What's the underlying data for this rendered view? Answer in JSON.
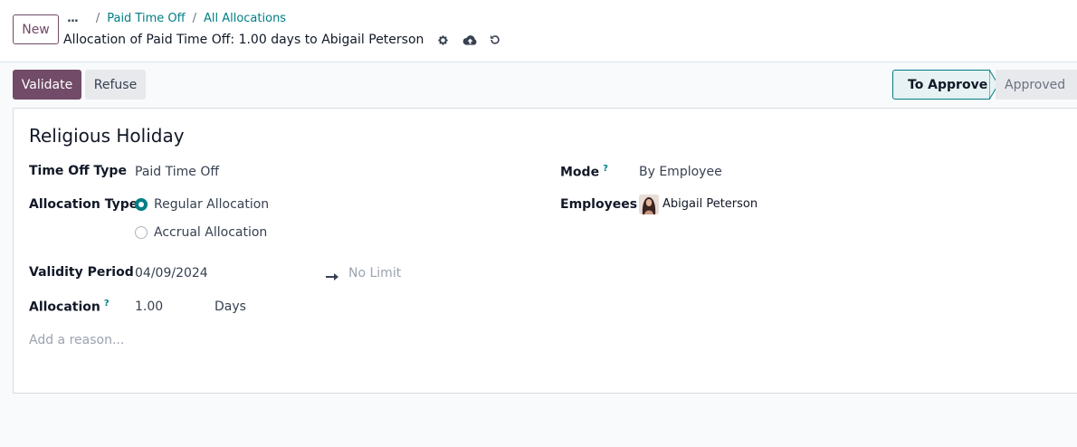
{
  "control_panel": {
    "new_label": "New",
    "breadcrumb": {
      "ellipsis": "...",
      "items": [
        "Paid Time Off",
        "All Allocations"
      ]
    },
    "record_title": "Allocation of Paid Time Off: 1.00 days to Abigail Peterson"
  },
  "status_bar": {
    "validate_label": "Validate",
    "refuse_label": "Refuse",
    "stages": [
      "To Approve",
      "Approved"
    ],
    "current_stage": "To Approve"
  },
  "form": {
    "name": "Religious Holiday",
    "time_off_type": {
      "label": "Time Off Type",
      "value": "Paid Time Off"
    },
    "allocation_type": {
      "label": "Allocation Type",
      "options": [
        "Regular Allocation",
        "Accrual Allocation"
      ],
      "selected": "Regular Allocation"
    },
    "validity_period": {
      "label": "Validity Period",
      "start": "04/09/2024",
      "end_placeholder": "No Limit"
    },
    "allocation": {
      "label": "Allocation",
      "help": "?",
      "value": "1.00",
      "unit": "Days"
    },
    "reason_placeholder": "Add a reason...",
    "mode": {
      "label": "Mode",
      "help": "?",
      "value": "By Employee"
    },
    "employees": {
      "label": "Employees",
      "values": [
        "Abigail Peterson"
      ]
    }
  },
  "colors": {
    "brand": "#714b67",
    "accent": "#017e84"
  }
}
